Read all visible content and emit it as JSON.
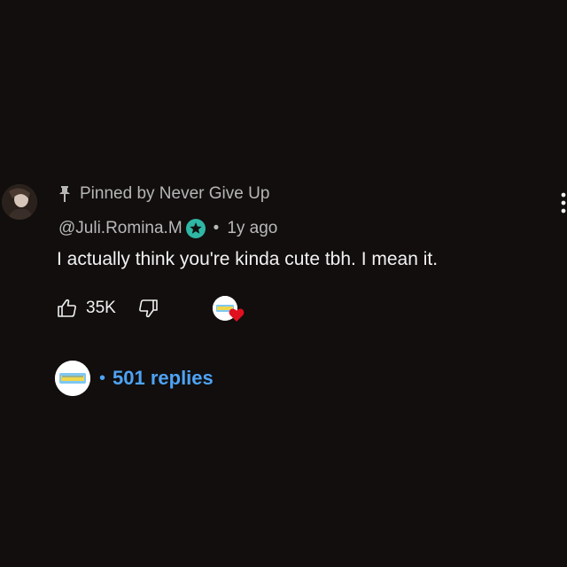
{
  "comment": {
    "pinned_label": "Pinned by Never Give Up",
    "author_handle": "@Juli.Romina.M",
    "separator": "•",
    "timestamp": "1y ago",
    "text": "I actually think you're kinda cute tbh. I mean it.",
    "like_count": "35K",
    "icons": {
      "pin": "pin-icon",
      "badge": "star-badge-icon",
      "like": "thumbs-up-icon",
      "dislike": "thumbs-down-icon",
      "creator_heart": "heart-icon",
      "menu": "more-vert-icon"
    }
  },
  "replies": {
    "separator": "•",
    "label": "501 replies"
  },
  "colors": {
    "background": "#110e0d",
    "accent_blue": "#4ea3f5",
    "badge_teal": "#2fb7a5",
    "heart_red": "#e0101f"
  }
}
